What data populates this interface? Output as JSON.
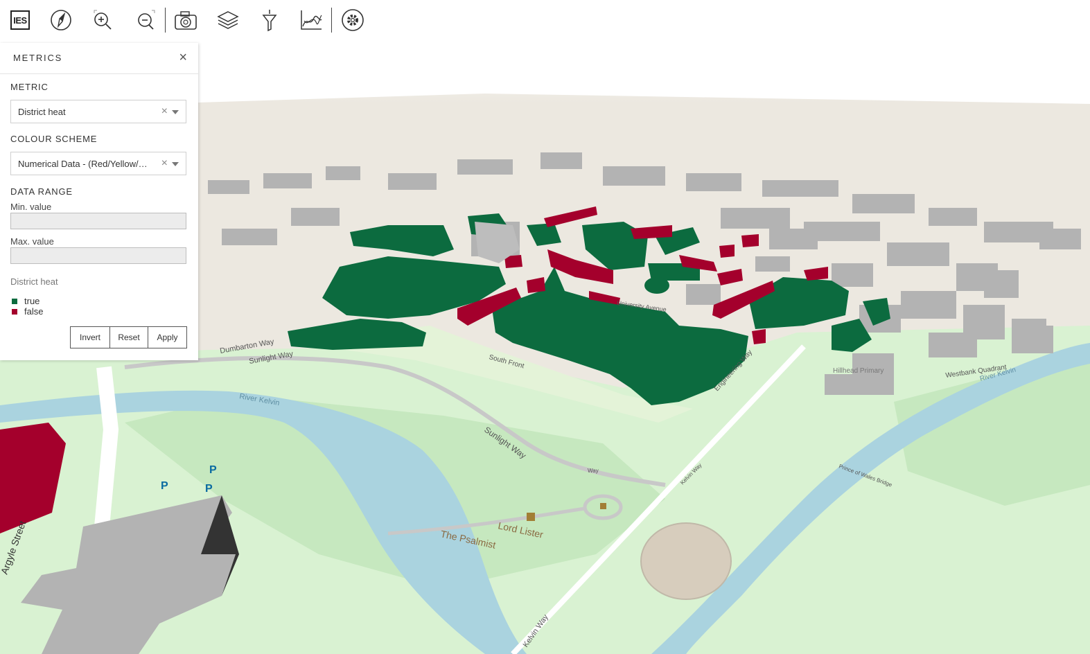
{
  "toolbar": {
    "logo_text": "IES",
    "icons": [
      "ies-logo",
      "compass-icon",
      "zoom-in-icon",
      "zoom-out-icon",
      "camera-icon",
      "layers-icon",
      "filter-icon",
      "chart-icon",
      "settings-icon"
    ]
  },
  "panel": {
    "title": "METRICS",
    "close_glyph": "×",
    "metric_label": "METRIC",
    "metric_value": "District heat",
    "colour_scheme_label": "COLOUR SCHEME",
    "colour_scheme_value": "Numerical Data - (Red/Yellow/Green)",
    "data_range_label": "DATA RANGE",
    "min_label": "Min. value",
    "min_value": "",
    "max_label": "Max. value",
    "max_value": "",
    "legend_title": "District heat",
    "legend": [
      {
        "label": "true",
        "color": "#0c6b3f"
      },
      {
        "label": "false",
        "color": "#a4002c"
      }
    ],
    "buttons": {
      "invert": "Invert",
      "reset": "Reset",
      "apply": "Apply"
    }
  },
  "map": {
    "labels": {
      "dumbarton": "Dumbarton Way",
      "sunlight1": "Sunlight Way",
      "sunlight2": "Sunlight Way",
      "south_front": "South Front",
      "engineering": "Engineering Way",
      "river1": "River Kelvin",
      "river2": "River Kelvin",
      "lord_lister": "Lord Lister",
      "psalmist": "The Psalmist",
      "kelvin_way": "Kelvin Way",
      "kelvin_way2": "Kelvin Way",
      "westbank": "Westbank Quadrant",
      "hillhead": "Hillhead Primary",
      "argyle": "Argyle Street",
      "way": "Way",
      "university": "University Avenue",
      "prince": "Prince of Wales Bridge"
    },
    "colors": {
      "green": "#0c6b3f",
      "red": "#a4002c",
      "grey": "#a8a8a8",
      "park": "#d4f0cc",
      "river": "#aad3df"
    }
  }
}
